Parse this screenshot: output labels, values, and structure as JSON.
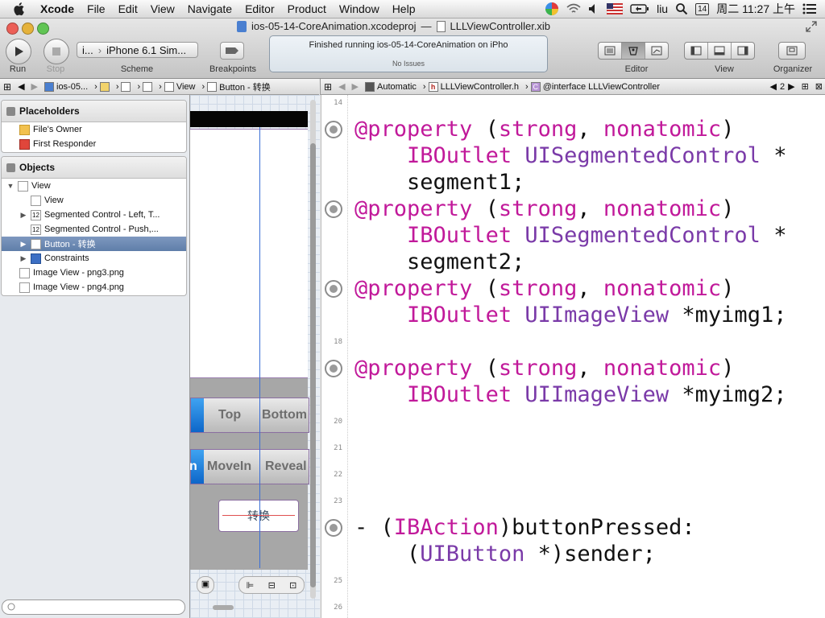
{
  "menubar": {
    "app": "Xcode",
    "items": [
      "File",
      "Edit",
      "View",
      "Navigate",
      "Editor",
      "Product",
      "Window",
      "Help"
    ],
    "user": "liu",
    "date_badge": "14",
    "clock": "周二 11:27 上午"
  },
  "window": {
    "project_title": "ios-05-14-CoreAnimation.xcodeproj",
    "separator": "—",
    "file_title": "LLLViewController.xib"
  },
  "toolbar": {
    "run_label": "Run",
    "stop_label": "Stop",
    "scheme_target": "i...",
    "scheme_device": "iPhone 6.1 Sim...",
    "scheme_label": "Scheme",
    "breakpoints_label": "Breakpoints",
    "activity_status": "Finished running ios-05-14-CoreAnimation on iPho",
    "activity_issues": "No Issues",
    "editor_label": "Editor",
    "view_label": "View",
    "organizer_label": "Organizer"
  },
  "left_jumpbar": [
    "ios-05...",
    "View",
    "Button - 转换"
  ],
  "right_jumpbar": {
    "mode": "Automatic",
    "file": "LLLViewController.h",
    "symbol": "@interface LLLViewController",
    "counter": "2"
  },
  "outline": {
    "placeholders_title": "Placeholders",
    "placeholders": [
      "File's Owner",
      "First Responder"
    ],
    "objects_title": "Objects",
    "objects": [
      {
        "label": "View",
        "indent": 0,
        "tri": "▼",
        "selected": false
      },
      {
        "label": "View",
        "indent": 1,
        "tri": "",
        "selected": false
      },
      {
        "label": "Segmented Control - Left, T...",
        "indent": 1,
        "tri": "▶",
        "selected": false
      },
      {
        "label": "Segmented Control - Push,...",
        "indent": 1,
        "tri": "",
        "selected": false
      },
      {
        "label": "Button - 转换",
        "indent": 1,
        "tri": "▶",
        "selected": true
      },
      {
        "label": "Constraints",
        "indent": 1,
        "tri": "▶",
        "selected": false
      },
      {
        "label": "Image View - png3.png",
        "indent": 0,
        "tri": "",
        "selected": false
      },
      {
        "label": "Image View - png4.png",
        "indent": 0,
        "tri": "",
        "selected": false
      }
    ]
  },
  "canvas": {
    "seg1_items": [
      "Top",
      "Bottom"
    ],
    "seg2_items": [
      "n",
      "MoveIn",
      "Reveal"
    ],
    "button_label": "转换"
  },
  "editor": {
    "line_numbers": [
      "14",
      "18",
      "20",
      "21",
      "22",
      "23",
      "25",
      "26"
    ],
    "code": [
      "@property (strong, nonatomic)",
      "    IBOutlet UISegmentedControl *",
      "    segment1;",
      "@property (strong, nonatomic)",
      "    IBOutlet UISegmentedControl *",
      "    segment2;",
      "@property (strong, nonatomic)",
      "    IBOutlet UIImageView *myimg1;",
      "@property (strong, nonatomic)",
      "    IBOutlet UIImageView *myimg2;",
      "- (IBAction)buttonPressed:",
      "    (UIButton *)sender;"
    ]
  },
  "colors": {
    "keyword": "#c1199a",
    "type": "#7a3aa8",
    "selection": "#6f8bb5"
  }
}
